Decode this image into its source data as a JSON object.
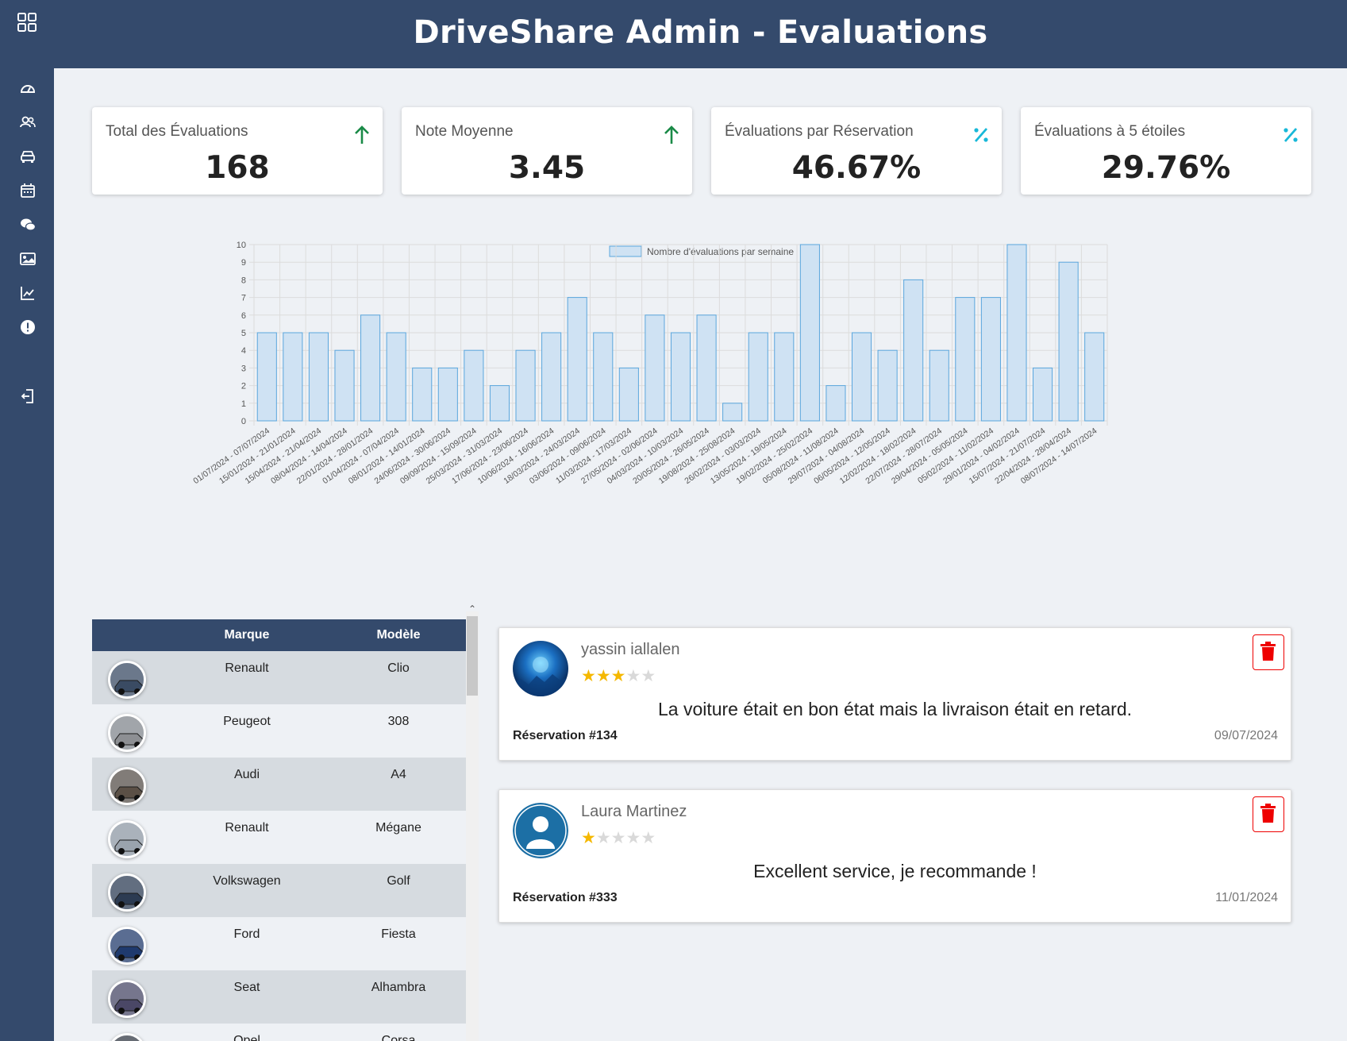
{
  "header": {
    "title": "DriveShare Admin - Evaluations"
  },
  "sidebar": {
    "items": [
      {
        "icon": "dashboard-icon"
      },
      {
        "icon": "users-icon"
      },
      {
        "icon": "car-icon"
      },
      {
        "icon": "calendar-icon"
      },
      {
        "icon": "chat-icon"
      },
      {
        "icon": "gallery-icon"
      },
      {
        "icon": "chart-line-icon"
      },
      {
        "icon": "alert-icon"
      },
      {
        "icon": "logout-icon"
      }
    ]
  },
  "kpis": [
    {
      "label": "Total des Évaluations",
      "value": "168",
      "icon": "arrow-up-icon",
      "color": "#1a8a47"
    },
    {
      "label": "Note Moyenne",
      "value": "3.45",
      "icon": "arrow-up-icon",
      "color": "#1a8a47"
    },
    {
      "label": "Évaluations par Réservation",
      "value": "46.67%",
      "icon": "percent-icon",
      "color": "#18b8d8"
    },
    {
      "label": "Évaluations à 5 étoiles",
      "value": "29.76%",
      "icon": "percent-icon",
      "color": "#18b8d8"
    }
  ],
  "chart_data": {
    "type": "bar",
    "legend": "Nombre d'évaluations par semaine",
    "legend_position": "top",
    "grid": true,
    "ylim": [
      0,
      10
    ],
    "yticks": [
      0,
      1,
      2,
      3,
      4,
      5,
      6,
      7,
      8,
      9,
      10
    ],
    "bar_fill": "#cfe2f3",
    "bar_stroke": "#5aa6dd",
    "categories": [
      "01/07/2024 - 07/07/2024",
      "15/01/2024 - 21/01/2024",
      "15/04/2024 - 21/04/2024",
      "08/04/2024 - 14/04/2024",
      "22/01/2024 - 28/01/2024",
      "01/04/2024 - 07/04/2024",
      "08/01/2024 - 14/01/2024",
      "24/06/2024 - 30/06/2024",
      "09/09/2024 - 15/09/2024",
      "25/03/2024 - 31/03/2024",
      "17/06/2024 - 23/06/2024",
      "10/06/2024 - 16/06/2024",
      "18/03/2024 - 24/03/2024",
      "03/06/2024 - 09/06/2024",
      "11/03/2024 - 17/03/2024",
      "27/05/2024 - 02/06/2024",
      "04/03/2024 - 10/03/2024",
      "20/05/2024 - 26/05/2024",
      "19/08/2024 - 25/08/2024",
      "26/02/2024 - 03/03/2024",
      "13/05/2024 - 19/05/2024",
      "19/02/2024 - 25/02/2024",
      "05/08/2024 - 11/08/2024",
      "29/07/2024 - 04/08/2024",
      "06/05/2024 - 12/05/2024",
      "12/02/2024 - 18/02/2024",
      "22/07/2024 - 28/07/2024",
      "29/04/2024 - 05/05/2024",
      "05/02/2024 - 11/02/2024",
      "29/01/2024 - 04/02/2024",
      "15/07/2024 - 21/07/2024",
      "22/04/2024 - 28/04/2024",
      "08/07/2024 - 14/07/2024"
    ],
    "values": [
      5,
      5,
      5,
      4,
      6,
      5,
      3,
      3,
      4,
      2,
      4,
      5,
      7,
      5,
      3,
      6,
      5,
      6,
      1,
      5,
      5,
      10,
      2,
      5,
      4,
      8,
      4,
      7,
      7,
      10,
      3,
      9,
      5
    ]
  },
  "vehicles_table": {
    "headers": {
      "brand": "Marque",
      "model": "Modèle"
    },
    "rows": [
      {
        "brand": "Renault",
        "model": "Clio",
        "thumb_color": "#3a4b63"
      },
      {
        "brand": "Peugeot",
        "model": "308",
        "thumb_color": "#8d8f93"
      },
      {
        "brand": "Audi",
        "model": "A4",
        "thumb_color": "#5b5046"
      },
      {
        "brand": "Renault",
        "model": "Mégane",
        "thumb_color": "#9aa3ad"
      },
      {
        "brand": "Volkswagen",
        "model": "Golf",
        "thumb_color": "#2c3b52"
      },
      {
        "brand": "Ford",
        "model": "Fiesta",
        "thumb_color": "#1f3a6e"
      },
      {
        "brand": "Seat",
        "model": "Alhambra",
        "thumb_color": "#4a4766"
      },
      {
        "brand": "Opel",
        "model": "Corsa",
        "thumb_color": "#333840"
      }
    ]
  },
  "reviews": [
    {
      "name": "yassin iallalen",
      "rating": 3,
      "comment": "La voiture était en bon état mais la livraison était en retard.",
      "reservation": "Réservation #134",
      "date": "09/07/2024",
      "avatar": "abstract-blue-avatar"
    },
    {
      "name": "Laura Martinez",
      "rating": 1,
      "comment": "Excellent service, je recommande !",
      "reservation": "Réservation #333",
      "date": "11/01/2024",
      "avatar": "default-user-avatar"
    }
  ]
}
